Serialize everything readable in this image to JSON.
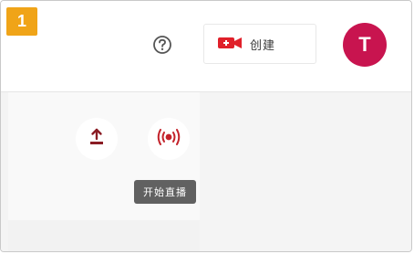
{
  "step": {
    "number": "1"
  },
  "header": {
    "help_icon": "help-circle-icon",
    "create_button": {
      "label": "创建",
      "icon": "video-camera-plus-icon",
      "icon_color": "#e0202a"
    },
    "avatar": {
      "initial": "T",
      "color": "#c8144f"
    }
  },
  "menu": {
    "items": [
      {
        "icon": "upload-icon",
        "icon_color": "#8a1c24"
      },
      {
        "icon": "live-broadcast-icon",
        "icon_color": "#c3222a"
      }
    ],
    "tooltip": "开始直播"
  },
  "colors": {
    "badge": "#f0a418",
    "accent": "#e0202a"
  }
}
